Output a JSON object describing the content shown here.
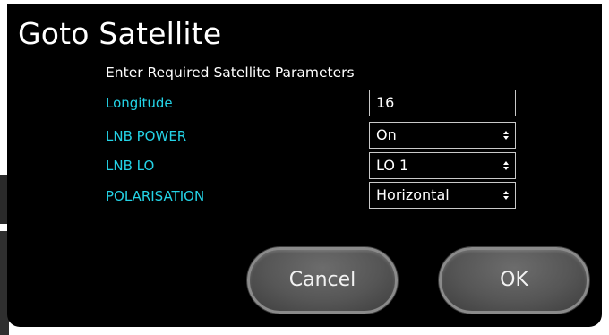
{
  "dialog": {
    "title": "Goto Satellite",
    "subtitle": "Enter Required Satellite Parameters"
  },
  "fields": [
    {
      "label": "Longitude",
      "value": "16",
      "kind": "text"
    },
    {
      "label": "LNB POWER",
      "value": "On",
      "kind": "select"
    },
    {
      "label": "LNB LO",
      "value": "LO 1",
      "kind": "select"
    },
    {
      "label": "POLARISATION",
      "value": "Horizontal",
      "kind": "select"
    }
  ],
  "buttons": {
    "cancel": "Cancel",
    "ok": "OK"
  },
  "colors": {
    "background": "#000000",
    "label_accent": "#24d3e6",
    "text": "#ffffff",
    "button_fill": "#5a5a5a",
    "button_border": "#8a8a8a"
  },
  "icons": {
    "select_arrow": "up-down-arrows-icon"
  }
}
